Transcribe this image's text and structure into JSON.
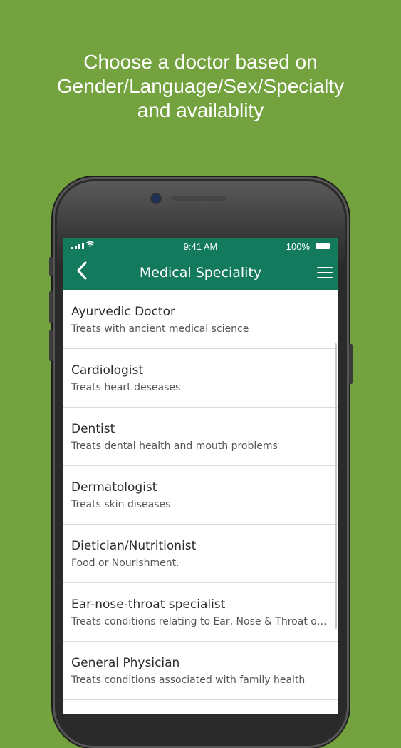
{
  "headline": {
    "line1": "Choose a doctor based on",
    "line2": "Gender/Language/Sex/Specialty",
    "line3": "and availablity"
  },
  "status_bar": {
    "time": "9:41 AM",
    "battery": "100%"
  },
  "app_bar": {
    "title": "Medical Speciality",
    "back_icon": "chevron-left-icon",
    "menu_icon": "hamburger-menu-icon"
  },
  "specialities": [
    {
      "name": "Ayurvedic Doctor",
      "desc": "Treats with ancient medical science"
    },
    {
      "name": "Cardiologist",
      "desc": "Treats heart deseases"
    },
    {
      "name": "Dentist",
      "desc": "Treats dental health and mouth problems"
    },
    {
      "name": "Dermatologist",
      "desc": "Treats skin diseases"
    },
    {
      "name": "Dietician/Nutritionist",
      "desc": "Food or Nourishment."
    },
    {
      "name": "Ear-nose-throat specialist",
      "desc": "Treats conditions relating to Ear, Nose & Throat o…"
    },
    {
      "name": "General Physician",
      "desc": "Treats conditions associated with family health"
    }
  ],
  "colors": {
    "background": "#74a23f",
    "app_bar": "#137a5e"
  }
}
